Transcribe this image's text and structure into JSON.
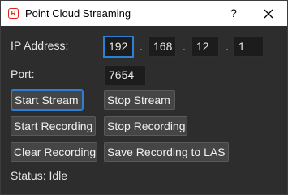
{
  "window": {
    "title": "Point Cloud Streaming",
    "help_label": "?",
    "app_icon_letter": "R",
    "accent_color": "#e0201b"
  },
  "form": {
    "ip_label": "IP Address:",
    "ip_octets": [
      "192",
      "168",
      "12",
      "1"
    ],
    "ip_separator": ".",
    "port_label": "Port:",
    "port_value": "7654"
  },
  "buttons": {
    "start_stream": "Start Stream",
    "stop_stream": "Stop Stream",
    "start_recording": "Start Recording",
    "stop_recording": "Stop Recording",
    "clear_recording": "Clear Recording",
    "save_recording": "Save Recording to LAS"
  },
  "status": {
    "text": "Status: Idle"
  }
}
